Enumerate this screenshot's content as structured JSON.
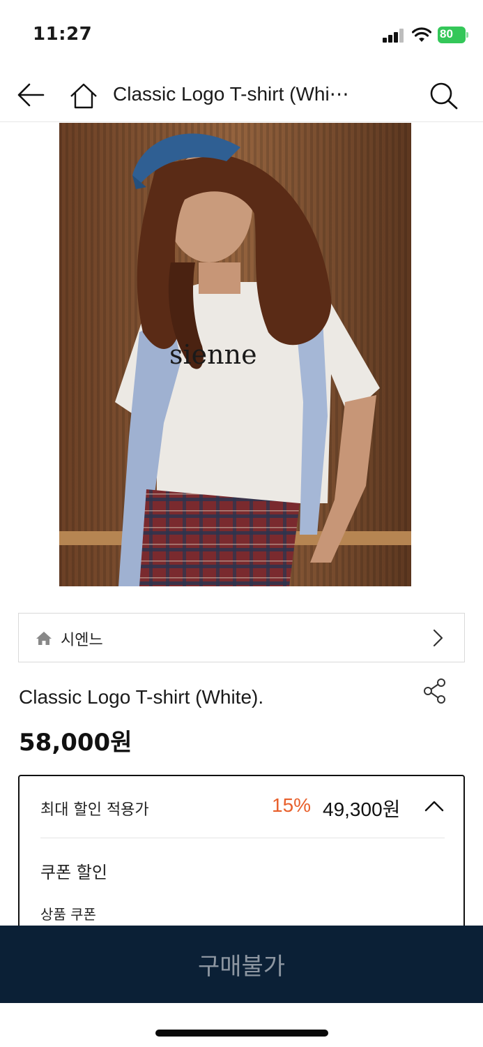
{
  "status": {
    "time": "11:27",
    "battery_level": "80",
    "icons": [
      "signal-icon",
      "wifi-icon",
      "battery-icon"
    ]
  },
  "nav": {
    "title": "Classic Logo T-shirt (Whi⋯",
    "icons": [
      "back-arrow-icon",
      "home-icon",
      "search-icon"
    ]
  },
  "product": {
    "image_alt_icon": "product-photo",
    "brand": "시엔느",
    "title": "Classic Logo T-shirt (White).",
    "price": "58,000원"
  },
  "discount": {
    "label": "최대 할인 적용가",
    "rate": "15%",
    "price": "49,300원",
    "coupon_heading": "쿠폰 할인",
    "coupon_sub": "상품 쿠폰",
    "expanded": true
  },
  "buy": {
    "label": "구매불가"
  },
  "colors": {
    "accent": "#e8602c",
    "buy_bar": "#0b2036",
    "battery": "#34c759"
  }
}
